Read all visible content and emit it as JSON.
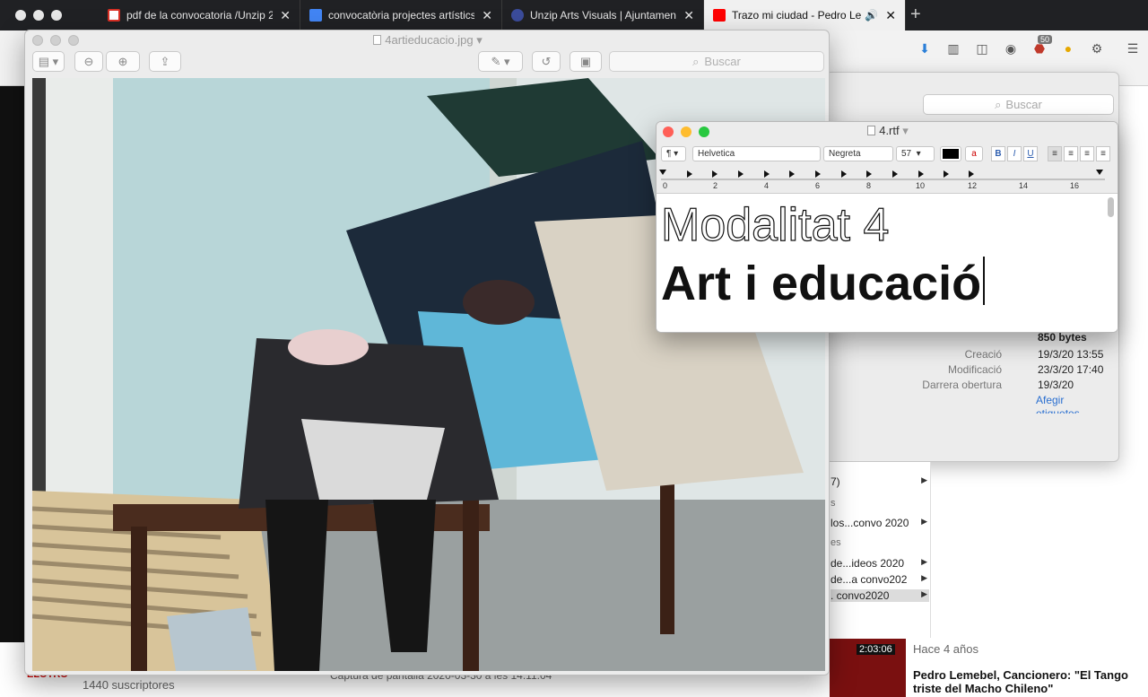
{
  "browser": {
    "tabs": [
      {
        "label": "pdf de la convocatoria /Unzip 2",
        "icon": "gmail-icon"
      },
      {
        "label": "convocatòria projectes artístics",
        "icon": "docs-icon"
      },
      {
        "label": "Unzip Arts Visuals | Ajuntament",
        "icon": "site-icon"
      },
      {
        "label": "Trazo mi ciudad - Pedro Lem",
        "icon": "youtube-icon",
        "active": true
      }
    ],
    "badge_count": "50"
  },
  "preview": {
    "title": "4artieducacio.jpg",
    "search_placeholder": "Buscar"
  },
  "finder_info": {
    "search_placeholder": "Buscar",
    "size": "850 bytes",
    "rows": [
      {
        "key": "Creació",
        "value": "19/3/20 13:55"
      },
      {
        "key": "Modificació",
        "value": "23/3/20 17:40"
      },
      {
        "key": "Darrera obertura",
        "value": "19/3/20"
      }
    ],
    "add_tags": "Afegir etiquetes"
  },
  "finder_list": {
    "items": [
      {
        "label": "7)"
      },
      {
        "label": "s"
      },
      {
        "label": "los...convo 2020"
      },
      {
        "label": "es"
      },
      {
        "label": "de...ideos 2020"
      },
      {
        "label": "de...a convo202"
      },
      {
        "label": ". convo2020"
      }
    ]
  },
  "textedit": {
    "title": "4.rtf",
    "para_style": "¶",
    "font": "Helvetica",
    "weight": "Negreta",
    "size": "57",
    "ruler_numbers": [
      "0",
      "2",
      "4",
      "6",
      "8",
      "10",
      "12",
      "14",
      "16"
    ],
    "line1": "Modalitat 4",
    "line2": "Art i educació"
  },
  "youtube_bg": {
    "channel_name": "elotro",
    "logo_text": "ELOTRO",
    "subscribers": "1440 suscriptores",
    "video_title": "Pedro Lemebel, Cancionero: \"El Tango triste del Macho Chileno\"",
    "duration": "2:03:06",
    "age": "Hace 4 años",
    "bottom_file": "Captura de pantalla 2020-03-30 a les 14:11:04"
  }
}
